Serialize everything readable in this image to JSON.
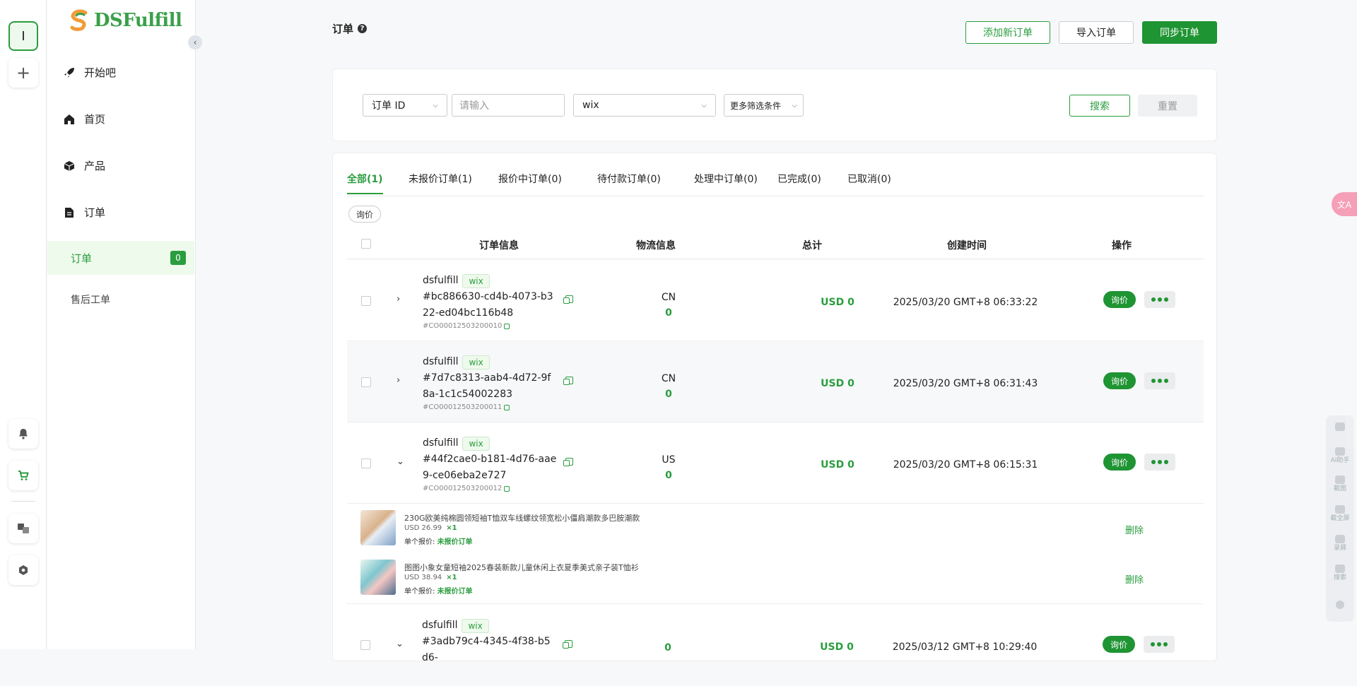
{
  "rail": {
    "workspace_initial": "I",
    "add_label": "+"
  },
  "brand": {
    "name": "DSFulfill",
    "accent": "#2a9d3e"
  },
  "sidebar": {
    "items": [
      {
        "label": "开始吧",
        "icon": "rocket-icon"
      },
      {
        "label": "首页",
        "icon": "home-icon"
      },
      {
        "label": "产品",
        "icon": "box-icon"
      },
      {
        "label": "订单",
        "icon": "document-icon"
      }
    ],
    "sub_items": [
      {
        "label": "订单",
        "badge": "0"
      },
      {
        "label": "售后工单"
      }
    ]
  },
  "page": {
    "title": "订单",
    "help": "?"
  },
  "toolbar": {
    "add_order": "添加新订单",
    "import_order": "导入订单",
    "sync_order": "同步订单"
  },
  "filters": {
    "field_select": "订单 ID",
    "search_placeholder": "请输入",
    "store_select": "wix",
    "more_filters": "更多筛选条件",
    "search_button": "搜索",
    "reset_button": "重置"
  },
  "tabs": [
    "全部(1)",
    "未报价订单(1)",
    "报价中订单(0)",
    "待付款订单(0)",
    "处理中订单(0)",
    "已完成(0)",
    "已取消(0)"
  ],
  "chip": "询价",
  "columns": [
    "订单信息",
    "物流信息",
    "总计",
    "创建时间",
    "操作"
  ],
  "orders": [
    {
      "store": "dsfulfill",
      "platform": "wix",
      "id": "#bc886630-cd4b-4073-b322-ed04bc116b48",
      "code": "#CO00012503200010",
      "country": "CN",
      "count": "0",
      "total": "USD 0",
      "created": "2025/03/20 GMT+8 06:33:22",
      "expand": "›",
      "inquiry": "询价"
    },
    {
      "store": "dsfulfill",
      "platform": "wix",
      "id": "#7d7c8313-aab4-4d72-9f8a-1c1c54002283",
      "code": "#CO00012503200011",
      "country": "CN",
      "count": "0",
      "total": "USD 0",
      "created": "2025/03/20 GMT+8 06:31:43",
      "expand": "›",
      "inquiry": "询价"
    },
    {
      "store": "dsfulfill",
      "platform": "wix",
      "id": "#44f2cae0-b181-4d76-aae9-ce06eba2e727",
      "code": "#CO00012503200012",
      "country": "US",
      "count": "0",
      "total": "USD 0",
      "created": "2025/03/20 GMT+8 06:15:31",
      "expand": "⌄",
      "inquiry": "询价"
    },
    {
      "store": "dsfulfill",
      "platform": "wix",
      "id": "#3adb79c4-4345-4f38-b5d6-",
      "code": "",
      "country": "",
      "count": "0",
      "total": "USD 0",
      "created": "2025/03/12 GMT+8 10:29:40",
      "expand": "⌄",
      "inquiry": "询价"
    }
  ],
  "line_items": [
    {
      "name": "230G欧美纯棉圆领短袖T恤双车线螺纹领宽松小僵肩潮款多巴胺潮款",
      "price": "USD 26.99",
      "qty": "×1",
      "quote_label": "单个报价:",
      "quote_status": "未报价订单",
      "delete": "删除"
    },
    {
      "name": "图图小象女童短袖2025春装新款儿童休闲上衣夏季美式亲子装T恤衫",
      "price": "USD 38.94",
      "qty": "×1",
      "quote_label": "单个报价:",
      "quote_status": "未报价订单",
      "delete": "删除"
    }
  ],
  "float_tools": {
    "lang": "文A",
    "labels": [
      "AI助手",
      "截图",
      "截全屏",
      "录屏",
      "搜索"
    ]
  }
}
